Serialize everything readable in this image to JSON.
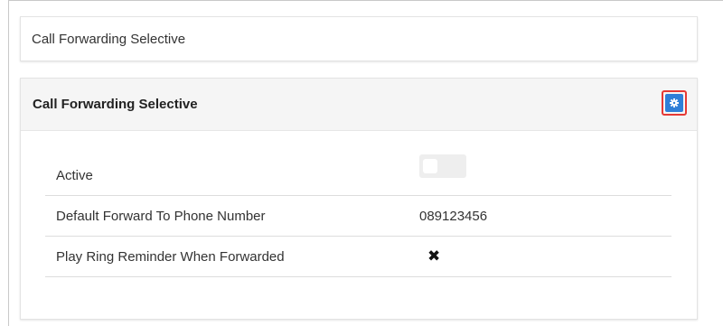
{
  "breadcrumb": {
    "label": "Call Forwarding Selective"
  },
  "panel": {
    "title": "Call Forwarding Selective",
    "settings_icon": "gear-icon",
    "highlight_color": "#e53935",
    "button_color": "#2f7fd8"
  },
  "settings": {
    "active": {
      "label": "Active",
      "value": false
    },
    "default_forward": {
      "label": "Default Forward To Phone Number",
      "value": "089123456"
    },
    "ring_reminder": {
      "label": "Play Ring Reminder When Forwarded",
      "value": "✖",
      "icon": "x-mark-icon"
    }
  }
}
